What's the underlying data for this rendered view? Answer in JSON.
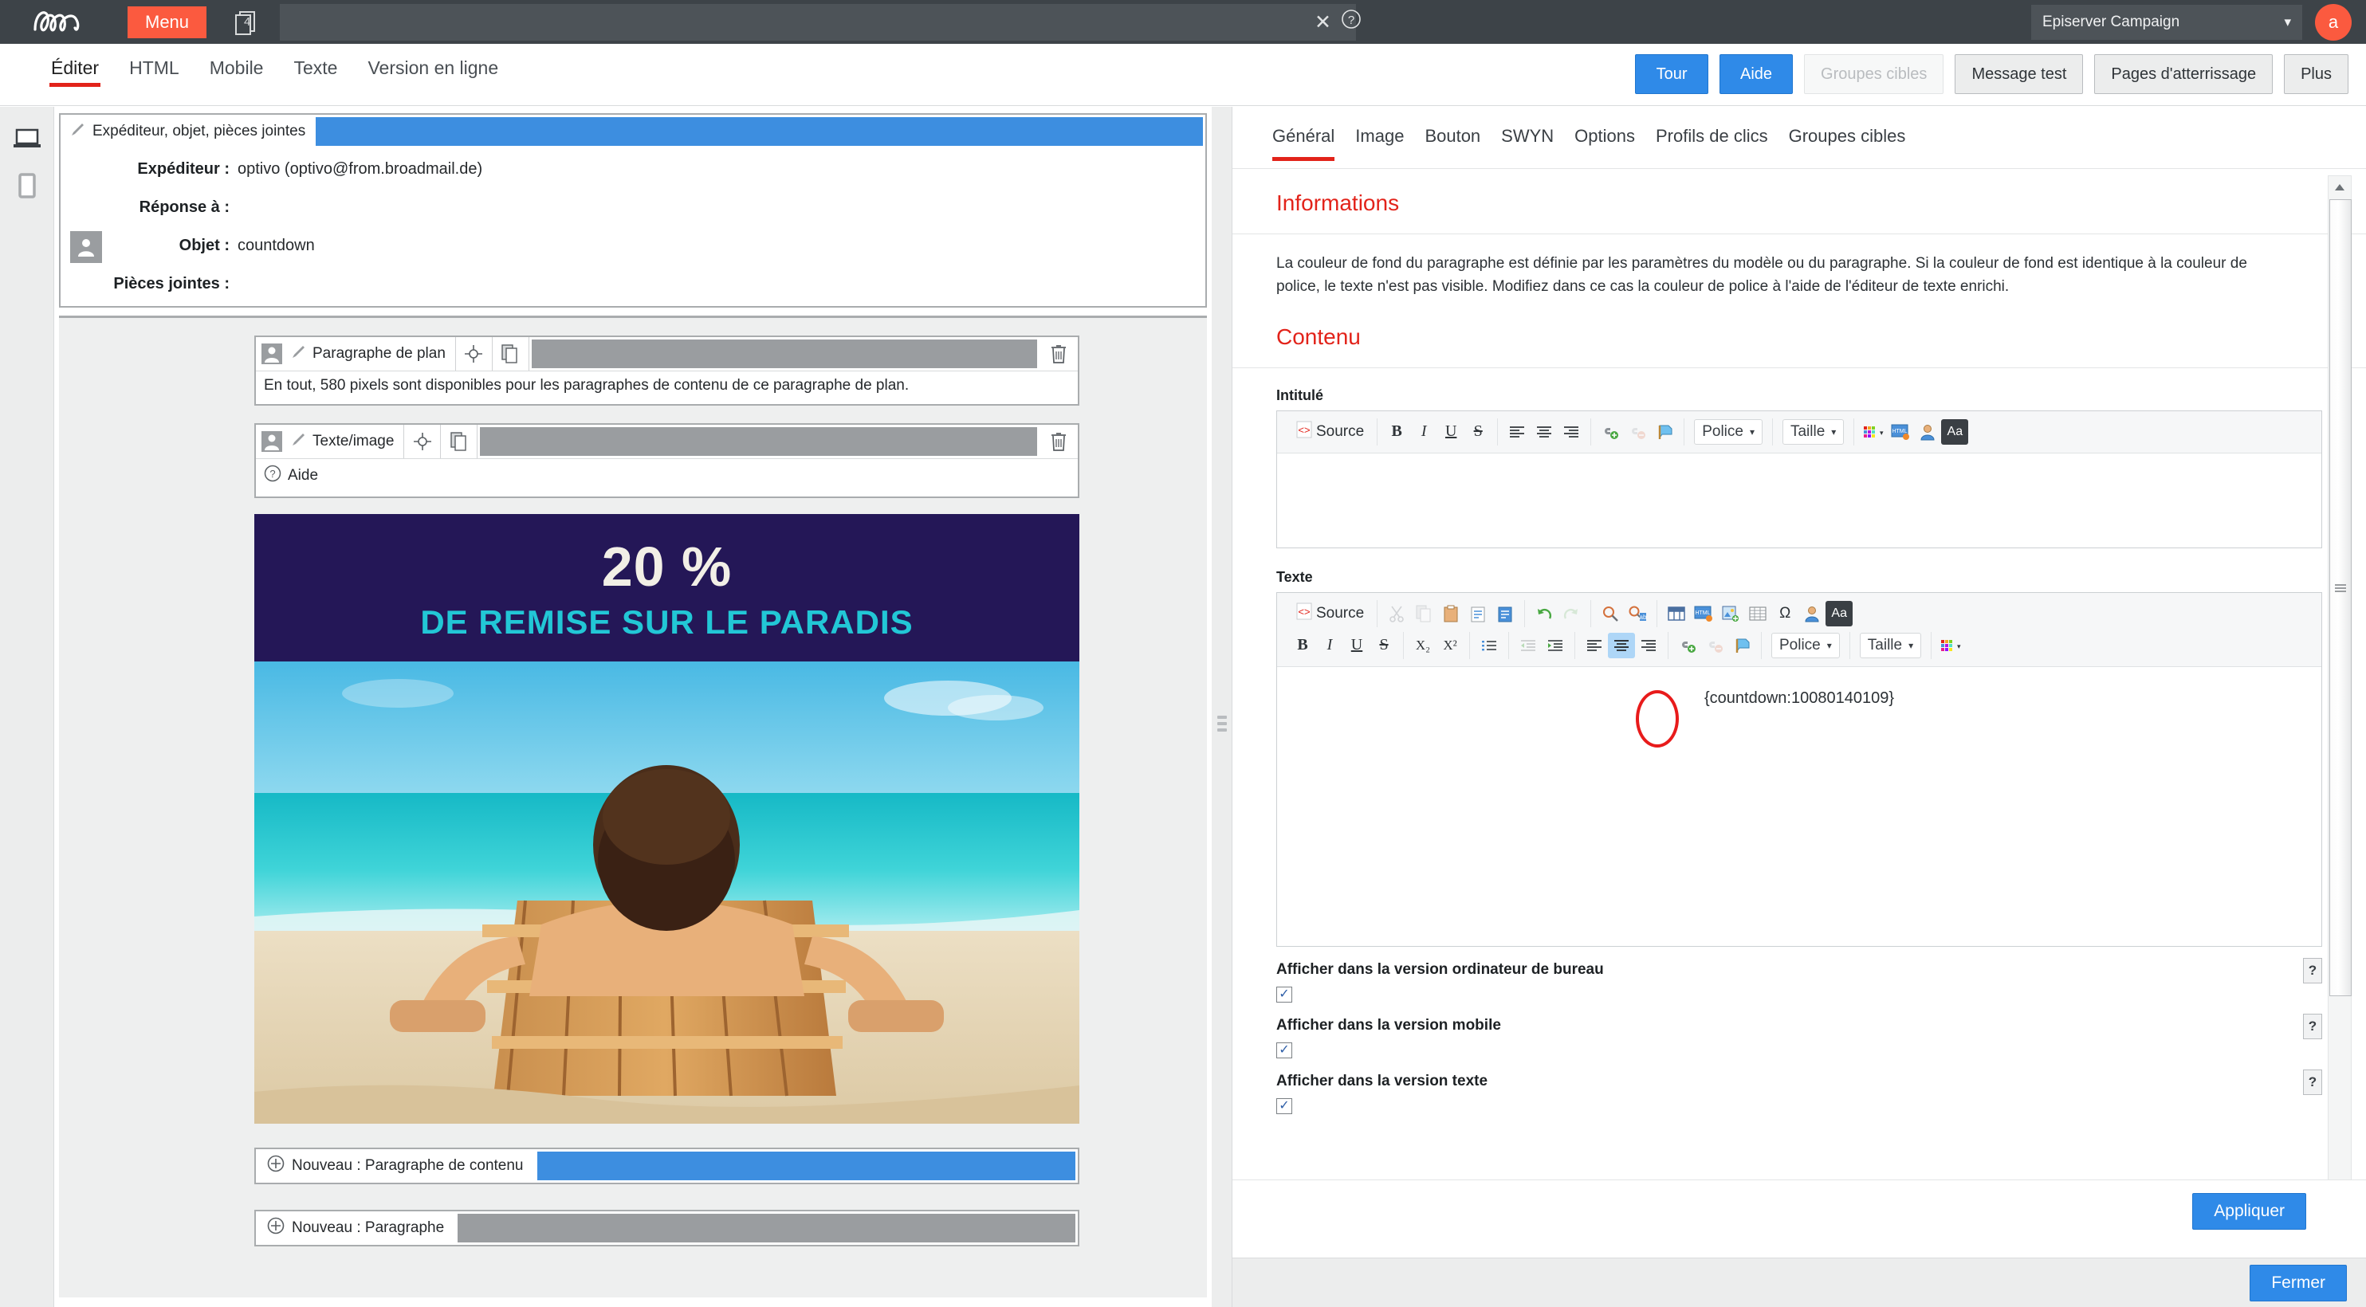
{
  "topbar": {
    "logo": "epi-logo",
    "menu_label": "Menu",
    "pages_badge": "4",
    "close_icon": "close-icon",
    "help_icon": "help-circle-icon",
    "account": "Episerver Campaign",
    "account_chevron": "chevron-down-icon",
    "avatar_initial": "a"
  },
  "main_tabs": [
    {
      "label": "Éditer",
      "active": true
    },
    {
      "label": "HTML",
      "active": false
    },
    {
      "label": "Mobile",
      "active": false
    },
    {
      "label": "Texte",
      "active": false
    },
    {
      "label": "Version en ligne",
      "active": false
    }
  ],
  "header_buttons": [
    {
      "label": "Tour",
      "style": "blue"
    },
    {
      "label": "Aide",
      "style": "blue"
    },
    {
      "label": "Groupes cibles",
      "style": "disabled"
    },
    {
      "label": "Message test",
      "style": "grey"
    },
    {
      "label": "Pages d'atterrissage",
      "style": "grey"
    },
    {
      "label": "Plus",
      "style": "grey"
    }
  ],
  "left_rail": [
    {
      "icon": "desktop-icon",
      "active": true
    },
    {
      "icon": "mobile-icon",
      "active": false
    }
  ],
  "mail_header": {
    "tab_label": "Expéditeur, objet, pièces jointes",
    "tab_icon": "brush-icon",
    "avatar_icon": "user-icon",
    "rows": [
      {
        "label": "Expéditeur :",
        "value": "optivo (optivo@from.broadmail.de)"
      },
      {
        "label": "Réponse à :",
        "value": ""
      },
      {
        "label": "Objet :",
        "value": "countdown"
      },
      {
        "label": "Pièces jointes :",
        "value": ""
      }
    ]
  },
  "preview_blocks": [
    {
      "name": "Paragraphe de plan",
      "user_icon": "user-icon",
      "brush_icon": "brush-icon",
      "move_icon": "move-target-icon",
      "copy_icon": "copy-icon",
      "trash_icon": "trash-icon",
      "text": "En tout, 580 pixels sont disponibles pour les paragraphes de contenu de ce paragraphe de plan."
    },
    {
      "name": "Texte/image",
      "user_icon": "user-icon",
      "brush_icon": "brush-icon",
      "move_icon": "move-target-icon",
      "copy_icon": "copy-icon",
      "trash_icon": "trash-icon",
      "help_icon": "help-circle-icon",
      "help_label": "Aide"
    }
  ],
  "banner": {
    "headline": "20 %",
    "subline": "DE REMISE SUR LE PARADIS",
    "bg_color": "#241757",
    "headline_color": "#f2efe6",
    "subline_color": "#22c7d6"
  },
  "photo_alt": "beach-lounger-photo",
  "new_blocks": [
    {
      "label": "Nouveau : Paragraphe de contenu",
      "icon": "plus-circle-icon",
      "fill": "#3d8ee0"
    },
    {
      "label": "Nouveau : Paragraphe",
      "icon": "plus-circle-icon",
      "fill": "#9a9da0"
    }
  ],
  "right_tabs": [
    {
      "label": "Général",
      "active": true
    },
    {
      "label": "Image",
      "active": false
    },
    {
      "label": "Bouton",
      "active": false
    },
    {
      "label": "SWYN",
      "active": false
    },
    {
      "label": "Options",
      "active": false
    },
    {
      "label": "Profils de clics",
      "active": false
    },
    {
      "label": "Groupes cibles",
      "active": false
    }
  ],
  "informations": {
    "heading": "Informations",
    "text": "La couleur de fond du paragraphe est définie par les paramètres du modèle ou du paragraphe. Si la couleur de fond est identique à la couleur de police, le texte n'est pas visible. Modifiez dans ce cas la couleur de police à l'aide de l'éditeur de texte enrichi."
  },
  "contenu": {
    "heading": "Contenu",
    "intitule_label": "Intitulé",
    "intitule_value": "",
    "texte_label": "Texte",
    "texte_value": "{countdown:10080140109}"
  },
  "toolbar_intitule": {
    "source_label": "Source",
    "source_icon": "source-code-icon",
    "buttons": [
      {
        "icon": "bold-icon",
        "glyph": "B"
      },
      {
        "icon": "italic-icon",
        "glyph": "I"
      },
      {
        "icon": "underline-icon",
        "glyph": "U"
      },
      {
        "icon": "strikethrough-icon",
        "glyph": "S"
      },
      {
        "icon": "align-left-icon",
        "glyph": ""
      },
      {
        "icon": "align-center-icon",
        "glyph": ""
      },
      {
        "icon": "align-right-icon",
        "glyph": ""
      },
      {
        "icon": "link-icon",
        "glyph": ""
      },
      {
        "icon": "unlink-icon",
        "glyph": ""
      },
      {
        "icon": "anchor-icon",
        "glyph": ""
      }
    ],
    "police_label": "Police",
    "taille_label": "Taille",
    "color_icon": "text-color-icon",
    "html_icon": "html-snippet-icon",
    "personalize_icon": "personalization-icon",
    "case_icon": "text-case-icon",
    "case_glyph": "Aa"
  },
  "toolbar_texte": {
    "source_label": "Source",
    "source_icon": "source-code-icon",
    "row1_icons": [
      "cut-icon",
      "copy-icon",
      "paste-icon",
      "paste-text-icon",
      "paste-word-icon",
      "undo-icon",
      "redo-icon",
      "find-icon",
      "replace-icon",
      "table-icon",
      "html-snippet-icon",
      "image-icon",
      "grid-icon",
      "omega-icon",
      "personalization-icon",
      "text-case-icon"
    ],
    "row2_buttons": [
      {
        "icon": "bold-icon",
        "glyph": "B"
      },
      {
        "icon": "italic-icon",
        "glyph": "I"
      },
      {
        "icon": "underline-icon",
        "glyph": "U"
      },
      {
        "icon": "strikethrough-icon",
        "glyph": "S"
      },
      {
        "icon": "subscript-icon",
        "glyph": "X₂"
      },
      {
        "icon": "superscript-icon",
        "glyph": "X²"
      },
      {
        "icon": "bullet-list-icon",
        "glyph": ""
      },
      {
        "icon": "outdent-icon",
        "glyph": ""
      },
      {
        "icon": "indent-icon",
        "glyph": ""
      },
      {
        "icon": "align-left-icon",
        "glyph": ""
      },
      {
        "icon": "align-center-icon",
        "glyph": "",
        "active": true
      },
      {
        "icon": "align-right-icon",
        "glyph": ""
      },
      {
        "icon": "link-icon",
        "glyph": ""
      },
      {
        "icon": "unlink-icon",
        "glyph": ""
      },
      {
        "icon": "anchor-icon",
        "glyph": ""
      }
    ],
    "police_label": "Police",
    "taille_label": "Taille",
    "color_icon": "text-color-icon",
    "case_glyph": "Aa",
    "highlight_color": "#e81b1b"
  },
  "checkboxes": [
    {
      "label": "Afficher dans la version ordinateur de bureau",
      "checked": true,
      "help": "?"
    },
    {
      "label": "Afficher dans la version mobile",
      "checked": true,
      "help": "?"
    },
    {
      "label": "Afficher dans la version texte",
      "checked": true,
      "help": "?"
    }
  ],
  "footer": {
    "apply_label": "Appliquer",
    "close_label": "Fermer"
  },
  "colors": {
    "accent_red": "#e2231a",
    "brand_orange": "#fb5a3f",
    "primary_blue": "#2f8ae8",
    "topbar_dark": "#3d4348"
  }
}
